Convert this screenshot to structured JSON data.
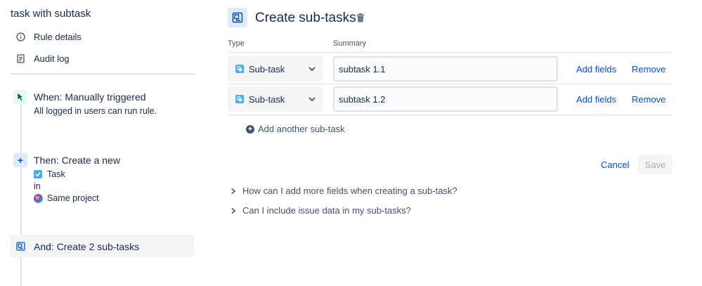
{
  "sidebar": {
    "rule_title": "task with subtask",
    "links": [
      {
        "label": "Rule details",
        "icon": "info-icon"
      },
      {
        "label": "Audit log",
        "icon": "document-icon"
      }
    ],
    "steps": {
      "trigger": {
        "title": "When: Manually triggered",
        "desc": "All logged in users can run rule.",
        "icon": "cursor-icon"
      },
      "action": {
        "title": "Then: Create a new",
        "issue_type": "Task",
        "in_label": "in",
        "project": "Same project",
        "icon": "plus-icon"
      },
      "subtasks": {
        "title": "And: Create 2 sub-tasks",
        "icon": "subtask-icon"
      }
    }
  },
  "main": {
    "title": "Create sub-tasks",
    "columns": {
      "type": "Type",
      "summary": "Summary"
    },
    "rows": [
      {
        "type": "Sub-task",
        "summary": "subtask 1.1",
        "add_fields": "Add fields",
        "remove": "Remove"
      },
      {
        "type": "Sub-task",
        "summary": "subtask 1.2",
        "add_fields": "Add fields",
        "remove": "Remove"
      }
    ],
    "add_another": "Add another sub-task",
    "cancel": "Cancel",
    "save": "Save",
    "faq": [
      "How can I add more fields when creating a sub-task?",
      "Can I include issue data in my sub-tasks?"
    ]
  },
  "colors": {
    "link": "#0052cc",
    "text": "#172b4d",
    "subtle": "#42526e",
    "border": "#dfe1e6"
  }
}
